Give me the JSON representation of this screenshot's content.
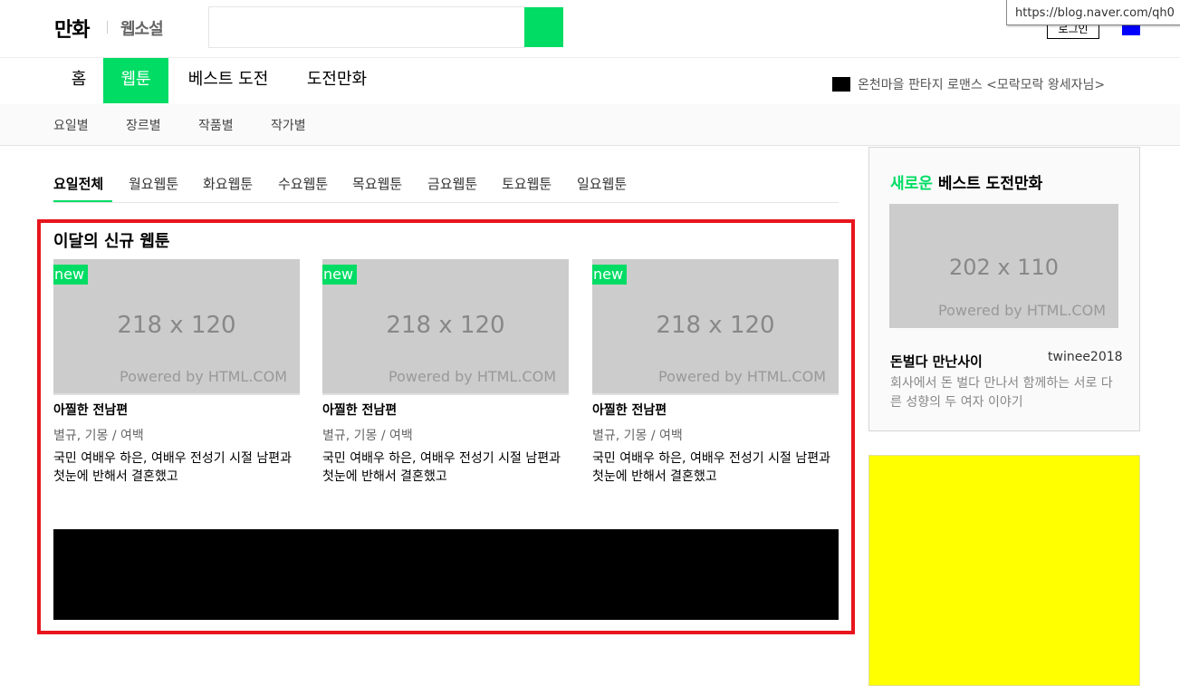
{
  "header": {
    "logo_main": "만화",
    "logo_sub": "웹소설",
    "login_label": "로그인",
    "tooltip": "https://blog.naver.com/qh0"
  },
  "main_nav": {
    "items": [
      "홈",
      "웹툰",
      "베스트 도전",
      "도전만화"
    ],
    "active_index": 1,
    "ticker": "온천마을 판타지 로맨스 <모락모락 왕세자님>"
  },
  "sub_nav": [
    "요일별",
    "장르별",
    "작품별",
    "작가별"
  ],
  "day_tabs": {
    "items": [
      "요일전체",
      "월요웹툰",
      "화요웹툰",
      "수요웹툰",
      "목요웹툰",
      "금요웹툰",
      "토요웹툰",
      "일요웹툰"
    ],
    "active_index": 0
  },
  "new_section": {
    "title": "이달의 신규 웹툰",
    "cards": [
      {
        "badge": "new",
        "thumb_size": "218 x 120",
        "thumb_powered": "Powered by HTML.COM",
        "title": "아찔한 전남편",
        "authors": "별규, 기몽 / 여백",
        "desc": "국민 여배우 하은, 여배우 전성기 시절 남편과 첫눈에 반해서 결혼했고"
      },
      {
        "badge": "new",
        "thumb_size": "218 x 120",
        "thumb_powered": "Powered by HTML.COM",
        "title": "아찔한 전남편",
        "authors": "별규, 기몽 / 여백",
        "desc": "국민 여배우 하은, 여배우 전성기 시절 남편과 첫눈에 반해서 결혼했고"
      },
      {
        "badge": "new",
        "thumb_size": "218 x 120",
        "thumb_powered": "Powered by HTML.COM",
        "title": "아찔한 전남편",
        "authors": "별규, 기몽 / 여백",
        "desc": "국민 여배우 하은, 여배우 전성기 시절 남편과 첫눈에 반해서 결혼했고"
      }
    ]
  },
  "best_challenge": {
    "title_highlight": "새로운",
    "title_rest": "베스트 도전만화",
    "thumb_size": "202 x 110",
    "thumb_powered": "Powered by HTML.COM",
    "name": "돈벌다 만난사이",
    "author": "twinee2018",
    "desc": "회사에서 돈 벌다 만나서 함께하는 서로 다른 성향의 두 여자 이야기"
  },
  "colors": {
    "accent": "#00dc64",
    "highlight_border": "#e8151d",
    "ad_yellow": "#ffff00",
    "blue_square": "#0000ff"
  }
}
